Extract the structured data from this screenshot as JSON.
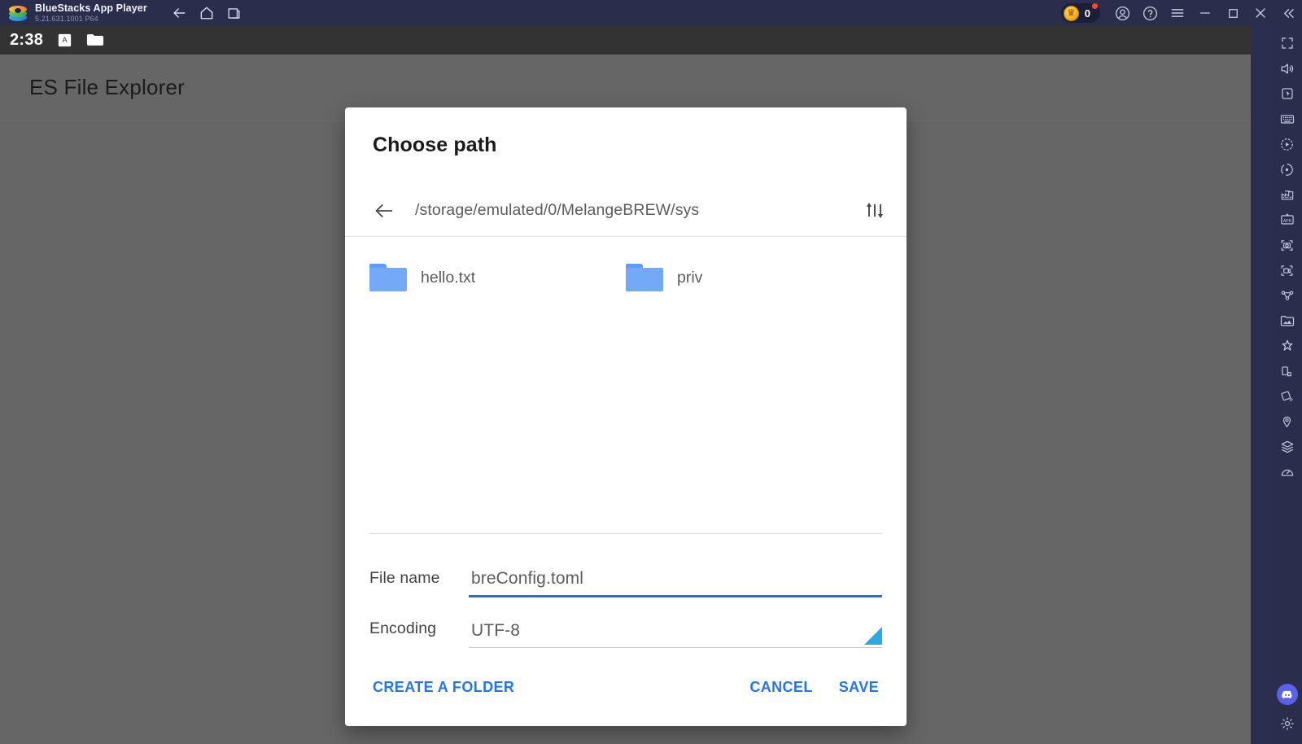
{
  "window": {
    "app_name": "BlueStacks App Player",
    "version": "5.21.631.1001 P64",
    "nav": [
      {
        "name": "back-button",
        "icon": "arrow-left-icon"
      },
      {
        "name": "home-button",
        "icon": "home-icon"
      },
      {
        "name": "multi-instance-button",
        "icon": "copy-icon"
      }
    ],
    "coin_count": "0",
    "right_buttons": [
      {
        "name": "account-button",
        "icon": "user-circle-icon"
      },
      {
        "name": "help-button",
        "icon": "question-circle-icon"
      },
      {
        "name": "menu-button",
        "icon": "hamburger-icon"
      },
      {
        "name": "minimize-button",
        "icon": "minimize-icon"
      },
      {
        "name": "maximize-button",
        "icon": "maximize-icon"
      },
      {
        "name": "close-button",
        "icon": "close-icon"
      },
      {
        "name": "collapse-sidebar-button",
        "icon": "chevron-double-left-icon"
      }
    ]
  },
  "right_toolbar": {
    "items": [
      {
        "name": "fullscreen-button",
        "icon": "fullscreen-icon"
      },
      {
        "name": "volume-button",
        "icon": "speaker-icon"
      },
      {
        "name": "keymapping-cursor-button",
        "icon": "pointer-square-icon"
      },
      {
        "name": "keyboard-controls-button",
        "icon": "keyboard-icon"
      },
      {
        "name": "macro-recorder-button",
        "icon": "play-circle-icon"
      },
      {
        "name": "script-button",
        "icon": "rotate-circle-icon"
      },
      {
        "name": "eco-mode-button",
        "icon": "factory-icon"
      },
      {
        "name": "install-apk-button",
        "icon": "apk-icon"
      },
      {
        "name": "screenshot-button",
        "icon": "camera-icon"
      },
      {
        "name": "screen-record-button",
        "icon": "video-record-icon"
      },
      {
        "name": "multi-instance-sync-button",
        "icon": "sync-instances-icon"
      },
      {
        "name": "media-manager-button",
        "icon": "gallery-icon"
      },
      {
        "name": "shake-button",
        "icon": "shake-icon"
      },
      {
        "name": "rotate-button",
        "icon": "rotate-device-icon"
      },
      {
        "name": "tilt-button",
        "icon": "tilt-icon"
      },
      {
        "name": "location-button",
        "icon": "location-pin-icon"
      },
      {
        "name": "layers-button",
        "icon": "layers-icon"
      },
      {
        "name": "performance-button",
        "icon": "speedometer-icon"
      }
    ],
    "discord": {
      "name": "discord-button",
      "icon": "discord-icon"
    },
    "settings": {
      "name": "settings-button",
      "icon": "gear-icon"
    }
  },
  "android": {
    "status_bar": {
      "clock": "2:38",
      "icons": [
        {
          "name": "keyboard-indicator-icon",
          "glyph": "A"
        },
        {
          "name": "folder-indicator-icon"
        }
      ]
    },
    "app_bar": {
      "title": "ES File Explorer"
    }
  },
  "dialog": {
    "title": "Choose path",
    "path_bar": {
      "back_icon": "arrow-left-icon",
      "path": "/storage/emulated/0/MelangeBREW/sys",
      "sort_icon": "sort-ascending-descending-icon"
    },
    "files": [
      {
        "name": "hello.txt",
        "icon": "folder-icon"
      },
      {
        "name": "priv",
        "icon": "folder-icon"
      }
    ],
    "fields": {
      "filename": {
        "label": "File name",
        "value": "breConfig.toml",
        "placeholder": "File name"
      },
      "encoding": {
        "label": "Encoding",
        "value": "UTF-8",
        "caret_icon": "dropdown-caret-icon",
        "options": [
          "UTF-8"
        ]
      }
    },
    "actions": {
      "create_folder": "CREATE A FOLDER",
      "cancel": "CANCEL",
      "save": "SAVE"
    }
  },
  "colors": {
    "accent_blue": "#2574f5",
    "folder_blue": "#74a9f7",
    "underline_active": "#2a6fd6",
    "caret_cyan": "#29abe2",
    "titlebar": "#2b2d4c",
    "scrim": "#666666"
  }
}
